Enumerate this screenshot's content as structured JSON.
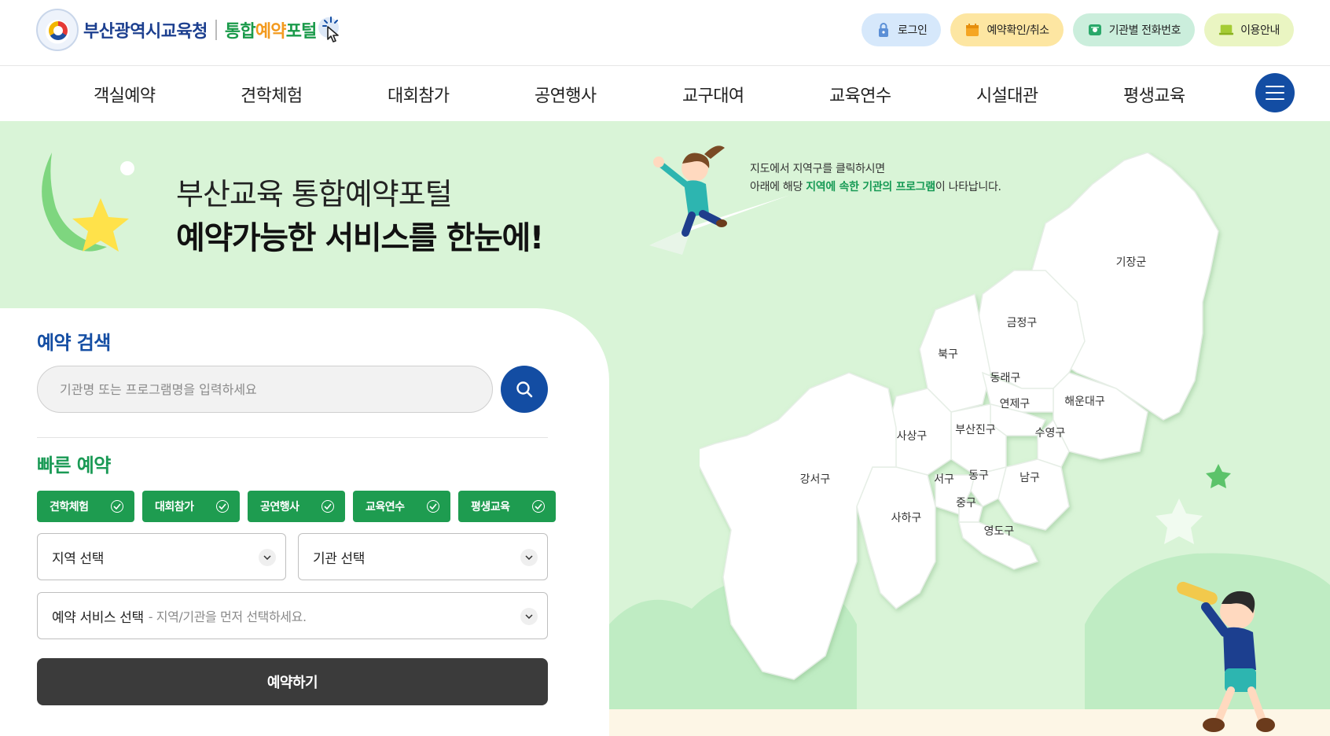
{
  "header": {
    "org_name": "부산광역시교육청",
    "portal_prefix": "통합",
    "portal_highlight": "예약",
    "portal_suffix": "포털",
    "util": [
      {
        "label": "로그인",
        "icon": "lock-icon"
      },
      {
        "label": "예약확인/취소",
        "icon": "calendar-icon"
      },
      {
        "label": "기관별 전화번호",
        "icon": "phone-icon"
      },
      {
        "label": "이용안내",
        "icon": "laptop-icon"
      }
    ]
  },
  "nav": {
    "items": [
      "객실예약",
      "견학체험",
      "대회참가",
      "공연행사",
      "교구대여",
      "교육연수",
      "시설대관",
      "평생교육"
    ],
    "menu_icon": "hamburger-menu-icon"
  },
  "hero": {
    "title": "부산교육 통합예약포털",
    "subtitle": "예약가능한 서비스를 한눈에!",
    "map_guide_line1": "지도에서 지역구를 클릭하시면",
    "map_guide_line2_pre": "아래에 해당 ",
    "map_guide_line2_em": "지역에 속한 기관의 프로그램",
    "map_guide_line2_post": "이 나타납니다."
  },
  "search": {
    "title": "예약 검색",
    "placeholder": "기관명 또는 프로그램명을 입력하세요"
  },
  "quick": {
    "title": "빠른 예약",
    "chips": [
      "견학체험",
      "대회참가",
      "공연행사",
      "교육연수",
      "평생교육"
    ],
    "region_select": "지역 선택",
    "org_select": "기관 선택",
    "service_select": "예약 서비스 선택",
    "service_hint": "- 지역/기관을 먼저 선택하세요.",
    "submit": "예약하기"
  },
  "map": {
    "districts": [
      "기장군",
      "금정구",
      "북구",
      "동래구",
      "연제구",
      "해운대구",
      "부산진구",
      "수영구",
      "사상구",
      "강서구",
      "서구",
      "동구",
      "남구",
      "중구",
      "사하구",
      "영도구"
    ]
  },
  "colors": {
    "primary_blue": "#134da3",
    "green": "#1e9c50",
    "hero_bg": "#d9f4d7",
    "dark_button": "#3b3b3b"
  }
}
